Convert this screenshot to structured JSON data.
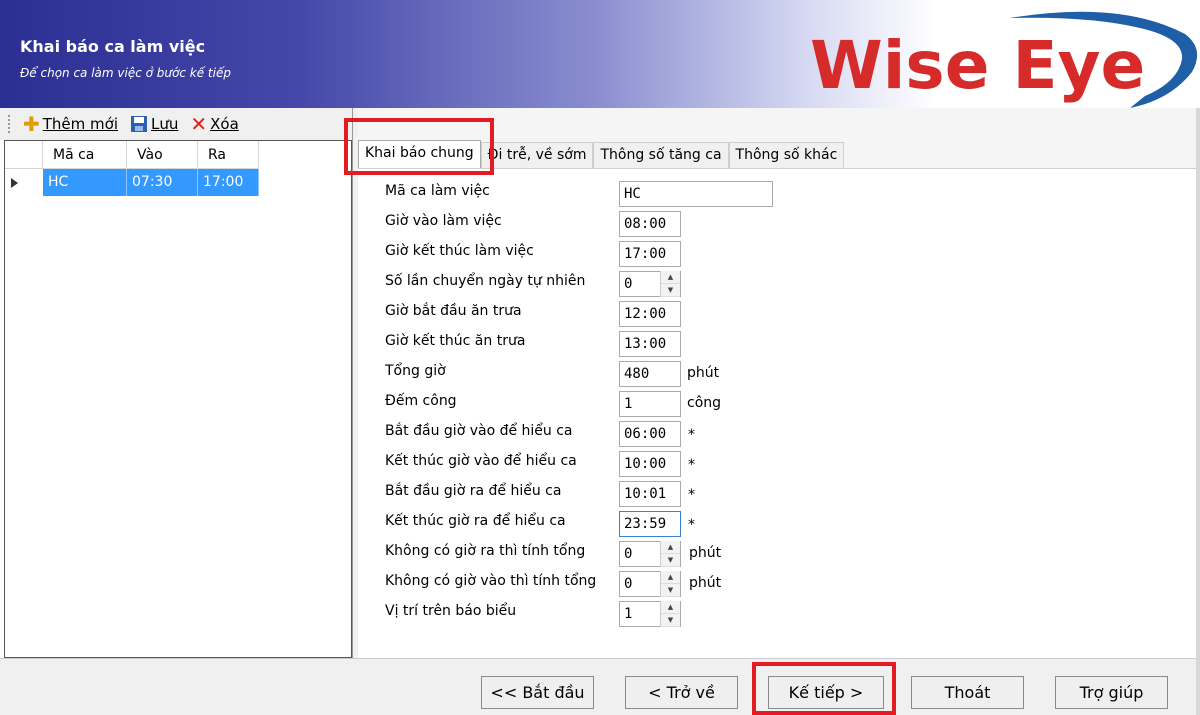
{
  "header": {
    "title": "Khai báo ca làm việc",
    "subtitle": "Để chọn ca làm việc ở bước kế tiếp",
    "logo_text": "Wise Eye"
  },
  "toolbar": {
    "add_label": "Thêm mới",
    "save_label": "Lưu",
    "delete_label": "Xóa"
  },
  "grid": {
    "columns": [
      "Mã ca",
      "Vào",
      "Ra"
    ],
    "rows": [
      {
        "ma_ca": "HC",
        "vao": "07:30",
        "ra": "17:00"
      }
    ]
  },
  "tabs": [
    "Khai báo chung",
    "Đi trễ, về sớm",
    "Thông số tăng ca",
    "Thông số khác"
  ],
  "form": {
    "fields": [
      {
        "label": "Mã ca làm việc",
        "value": "HC"
      },
      {
        "label": "Giờ vào làm việc",
        "value": "08:00"
      },
      {
        "label": "Giờ kết thúc làm việc",
        "value": "17:00"
      },
      {
        "label": "Số lần chuyển ngày tự nhiên",
        "value": "0"
      },
      {
        "label": "Giờ bắt đầu ăn trưa",
        "value": "12:00"
      },
      {
        "label": "Giờ kết thúc ăn trưa",
        "value": "13:00"
      },
      {
        "label": "Tổng giờ",
        "value": "480",
        "unit": "phút"
      },
      {
        "label": "Đếm công",
        "value": "1",
        "unit": "công"
      },
      {
        "label": "Bắt đầu giờ vào để hiểu ca",
        "value": "06:00",
        "unit": "*"
      },
      {
        "label": "Kết thúc giờ vào để hiểu ca",
        "value": "10:00",
        "unit": "*"
      },
      {
        "label": "Bắt đầu giờ ra để hiểu ca",
        "value": "10:01",
        "unit": "*"
      },
      {
        "label": "Kết thúc giờ ra để hiểu ca",
        "value": "23:59",
        "unit": "*"
      },
      {
        "label": "Không có giờ ra thì tính tổng",
        "value": "0",
        "unit": "phút"
      },
      {
        "label": "Không có giờ vào thì tính tổng",
        "value": "0",
        "unit": "phút"
      },
      {
        "label": "Vị trí trên báo biểu",
        "value": "1"
      }
    ]
  },
  "buttons": {
    "start": "<< Bắt đầu",
    "back": "< Trở về",
    "next": "Kế tiếp >",
    "exit": "Thoát",
    "help": "Trợ giúp"
  },
  "colors": {
    "header_dark": "#2b2e93",
    "selection": "#3399ff",
    "highlight": "#e31b23",
    "logo_red": "#d62b2b",
    "logo_blue": "#1f5fa8"
  }
}
